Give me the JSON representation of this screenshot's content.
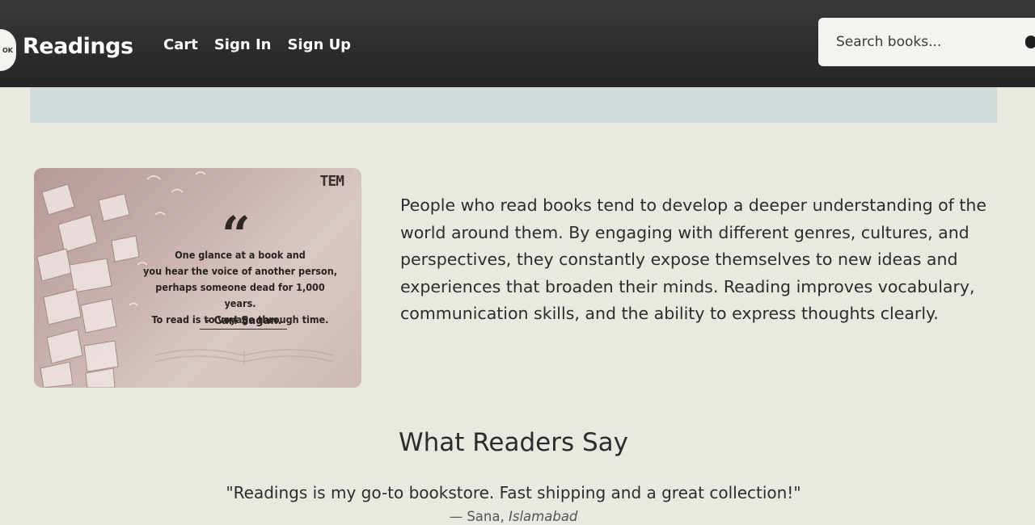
{
  "header": {
    "logo_text": "OK",
    "brand": "Readings",
    "nav": [
      {
        "label": "Cart"
      },
      {
        "label": "Sign In"
      },
      {
        "label": "Sign Up"
      }
    ],
    "search": {
      "placeholder": "Search books..."
    }
  },
  "quote_card": {
    "brand": "TEM",
    "mark": "“",
    "quote_lines": [
      "One glance at a book and",
      "you hear the voice of another person,",
      "perhaps someone dead for 1,000 years.",
      "To read is to voyage through time."
    ],
    "author": "– Carl Sagan."
  },
  "intro": {
    "paragraph": "People who read books tend to develop a deeper understanding of the world around them. By engaging with different genres, cultures, and perspectives, they constantly expose themselves to new ideas and experiences that broaden their minds. Reading improves vocabulary, communication skills, and the ability to express thoughts clearly."
  },
  "testimonials": {
    "title": "What Readers Say",
    "items": [
      {
        "text": "\"Readings is my go-to bookstore. Fast shipping and a great collection!\"",
        "author": "— Sana,",
        "location": "Islamabad"
      }
    ]
  }
}
